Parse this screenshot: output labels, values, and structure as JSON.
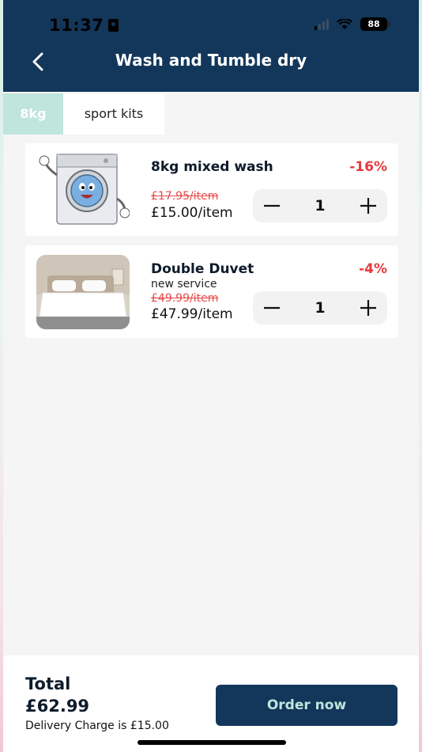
{
  "status": {
    "time": "11:37",
    "battery": "88"
  },
  "header": {
    "title": "Wash and Tumble dry",
    "back_icon": "chevron-left-icon"
  },
  "tabs": [
    {
      "label": "8kg",
      "active": true
    },
    {
      "label": "sport kits",
      "active": false
    }
  ],
  "items": [
    {
      "name": "8kg mixed wash",
      "subtitle": "",
      "old_price": "£17.95/item",
      "new_price": "£15.00/item",
      "discount": "-16%",
      "quantity": "1",
      "image": "washing-machine-cartoon-image"
    },
    {
      "name": "Double Duvet",
      "subtitle": "new service",
      "old_price": "£49.99/item",
      "new_price": "£47.99/item",
      "discount": "-4%",
      "quantity": "1",
      "image": "duvet-bed-photo"
    }
  ],
  "footer": {
    "total_label": "Total",
    "total_value": "£62.99",
    "delivery": "Delivery Charge is £15.00",
    "order_button": "Order now"
  },
  "colors": {
    "header_bg": "#13375a",
    "active_tab": "#bfe5dc",
    "discount": "#e8393d",
    "button_text": "#bfe5dc"
  }
}
